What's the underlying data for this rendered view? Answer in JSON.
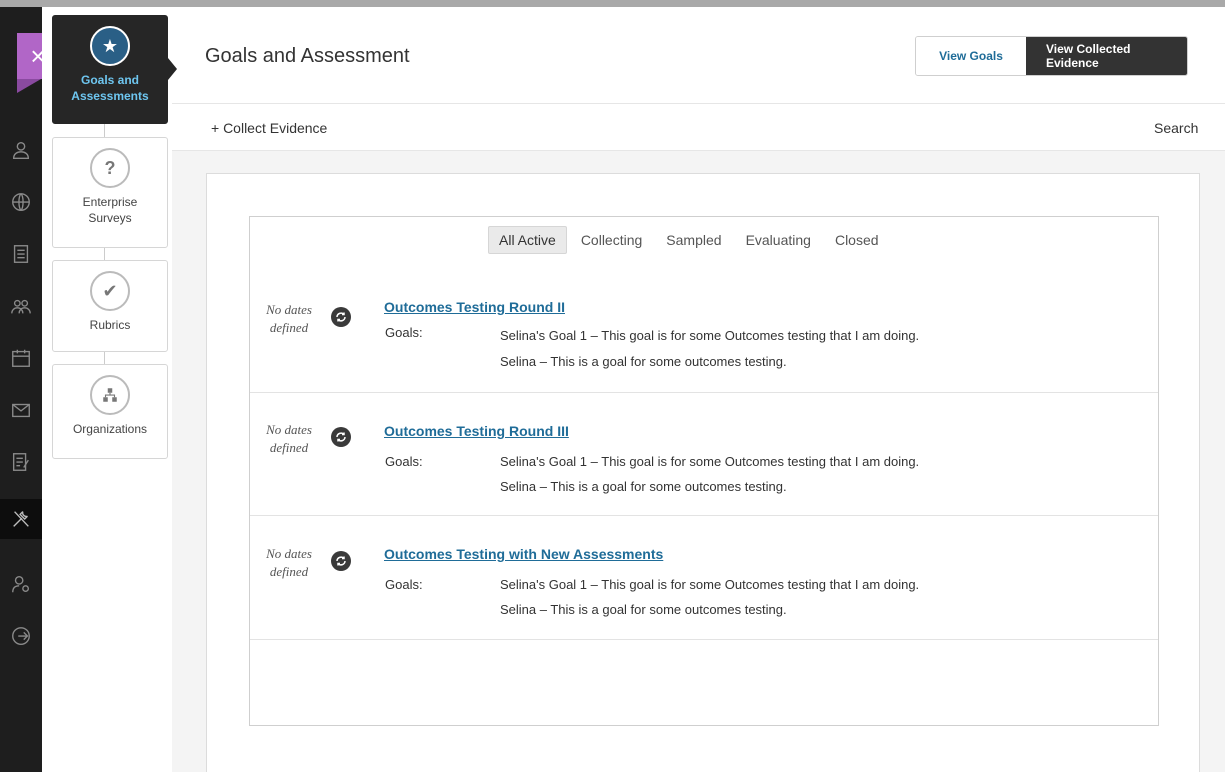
{
  "sidebar": {
    "close_label": "×",
    "tools": [
      {
        "label": "Goals and Assessments",
        "icon": "star-icon",
        "active": true
      },
      {
        "label": "Enterprise Surveys",
        "icon": "question-icon"
      },
      {
        "label": "Rubrics",
        "icon": "checkmark-icon"
      },
      {
        "label": "Organizations",
        "icon": "org-chart-icon"
      }
    ],
    "rail_icons": [
      "user-icon",
      "globe-icon",
      "courses-icon",
      "groups-icon",
      "calendar-icon",
      "mail-icon",
      "grades-icon",
      "tools-icon",
      "user-settings-icon",
      "sign-out-icon"
    ]
  },
  "header": {
    "title": "Goals and Assessment",
    "view_goals": "View Goals",
    "view_evidence": "View Collected Evidence"
  },
  "toolbar": {
    "collect": "+ Collect Evidence",
    "search": "Search"
  },
  "filters": [
    "All Active",
    "Collecting",
    "Sampled",
    "Evaluating",
    "Closed"
  ],
  "collections": [
    {
      "dates": "No dates defined",
      "title": "Outcomes Testing Round II",
      "goals_label": "Goals:",
      "goals": [
        "Selina's Goal 1 – This goal is for some Outcomes testing that I am doing.",
        "Selina – This is a goal for some outcomes testing."
      ]
    },
    {
      "dates": "No dates defined",
      "title": "Outcomes Testing Round III",
      "goals_label": "Goals:",
      "goals": [
        "Selina's Goal 1 – This goal is for some Outcomes testing that I am doing.",
        "Selina – This is a goal for some outcomes testing."
      ]
    },
    {
      "dates": "No dates defined",
      "title": "Outcomes Testing with New Assessments",
      "goals_label": "Goals:",
      "goals": [
        "Selina's Goal 1 – This goal is for some Outcomes testing that I am doing.",
        "Selina – This is a goal for some outcomes testing."
      ]
    }
  ],
  "colors": {
    "accent": "#1f6c98",
    "close": "#b166c7",
    "rail": "#1e1e1e"
  }
}
